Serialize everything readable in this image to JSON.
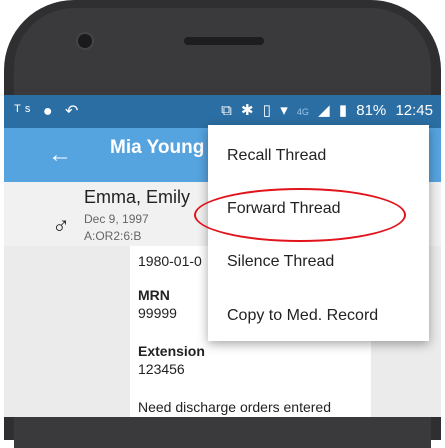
{
  "status_bar": {
    "left_icons": [
      "ts-icon",
      "android-icon",
      "call-missed-icon"
    ],
    "right_icons": [
      "screen-cast-icon",
      "bluetooth-icon",
      "vibrate-icon",
      "wifi-icon",
      "signal-icon",
      "battery-icon"
    ],
    "network": "4G",
    "battery": "81%",
    "time": "12:45"
  },
  "app_bar": {
    "title": "Mia Young"
  },
  "patient": {
    "name": "Emma, Emily",
    "dob": "Dec 9, 1997",
    "location": "A:OR2:6:B"
  },
  "details": {
    "dob_value": "1980-01-0",
    "mrn_label": "MRN",
    "mrn_value": "99999",
    "extension_label": "Extension",
    "extension_value": "123456",
    "note": "Need discharge orders entered"
  },
  "menu": {
    "items": [
      {
        "label": "Recall Thread"
      },
      {
        "label": "Forward Thread"
      },
      {
        "label": "Silence Thread"
      },
      {
        "label": "Copy to Med. Record"
      }
    ]
  },
  "colors": {
    "status_bar": "#2b6ea3",
    "app_bar": "#55a3df",
    "highlight": "#e2141b"
  }
}
